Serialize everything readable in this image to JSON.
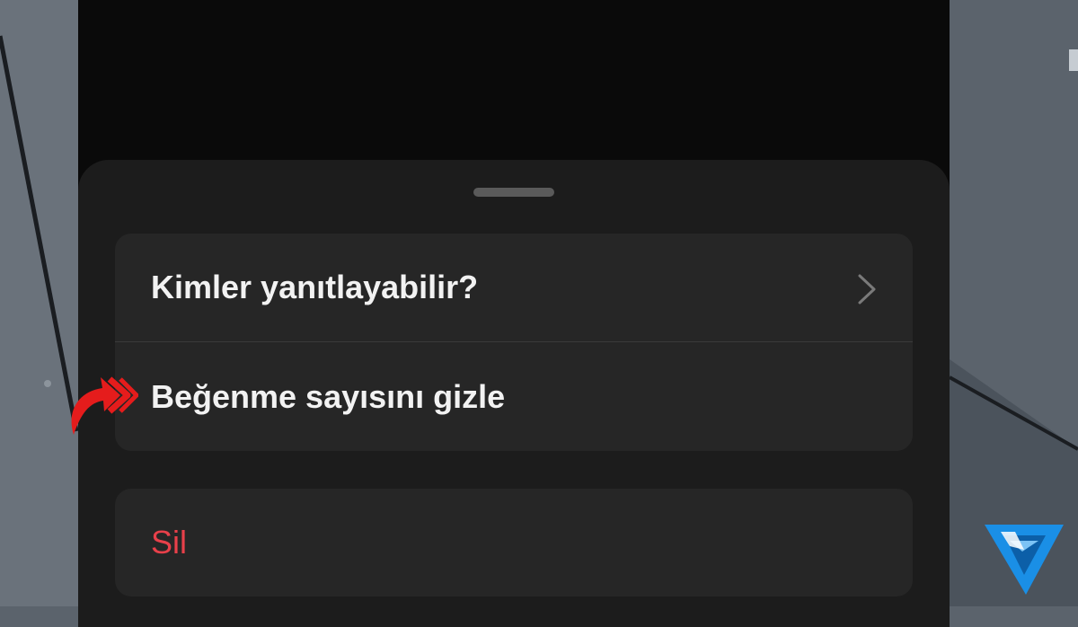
{
  "menu": {
    "items": [
      {
        "label": "Kimler yanıtlayabilir?",
        "icon": "chevron-right-icon"
      },
      {
        "label": "Beğenme sayısını gizle"
      }
    ],
    "danger_item": {
      "label": "Sil",
      "color": "#e8404a"
    }
  },
  "annotation": {
    "icon": "red-arrow-icon",
    "color": "#e51c1c"
  },
  "watermark": {
    "icon": "logo-icon",
    "color": "#1a8fe6"
  }
}
